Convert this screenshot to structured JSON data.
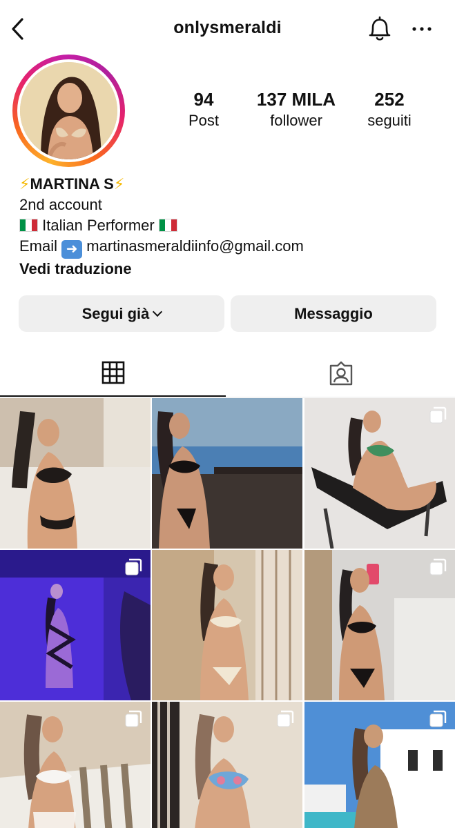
{
  "header": {
    "username": "onlysmeraldi",
    "back_icon": "chevron-left-icon",
    "bell_icon": "bell-icon",
    "more_icon": "more-horizontal-icon"
  },
  "stats": [
    {
      "value": "94",
      "label": "Post"
    },
    {
      "value": "137 MILA",
      "label": "follower"
    },
    {
      "value": "252",
      "label": "seguiti"
    }
  ],
  "bio": {
    "name": "MARTINA S",
    "line1": "2nd account",
    "line2": "Italian Performer",
    "email_label": "Email",
    "email": "martinasmeraldiinfo@gmail.com",
    "translate": "Vedi traduzione"
  },
  "buttons": {
    "follow": "Segui già",
    "message": "Messaggio"
  },
  "tabs": [
    {
      "icon": "grid-icon",
      "active": true
    },
    {
      "icon": "tagged-user-icon",
      "active": false
    }
  ],
  "colors": {
    "story_ring": [
      "#fdb22b",
      "#f9661f",
      "#e5226d",
      "#c51fa6"
    ],
    "button_bg": "#efefef",
    "flag": [
      "#009246",
      "#ffffff",
      "#ce2b37"
    ]
  },
  "posts": [
    {
      "multiple": false,
      "palette": [
        "#cdbfae",
        "#6e5a4a",
        "#2b2420"
      ]
    },
    {
      "multiple": false,
      "palette": [
        "#4b7fb4",
        "#8aa9c2",
        "#2a2020"
      ]
    },
    {
      "multiple": true,
      "palette": [
        "#e7e4e2",
        "#cfc9c5",
        "#1f1d1d"
      ]
    },
    {
      "multiple": true,
      "palette": [
        "#4d2ed8",
        "#2a1a8c",
        "#9b6ad6"
      ]
    },
    {
      "multiple": false,
      "palette": [
        "#d6c6ae",
        "#a8896a",
        "#3a2b23"
      ]
    },
    {
      "multiple": true,
      "palette": [
        "#d8d6d3",
        "#b39a7c",
        "#252020"
      ]
    },
    {
      "multiple": true,
      "palette": [
        "#d9cbb8",
        "#efece6",
        "#6d5546"
      ]
    },
    {
      "multiple": true,
      "palette": [
        "#e6ddd0",
        "#2c2624",
        "#8c6f5c"
      ]
    },
    {
      "multiple": true,
      "palette": [
        "#4f8fd6",
        "#ffffff",
        "#9c7b5a"
      ]
    }
  ]
}
